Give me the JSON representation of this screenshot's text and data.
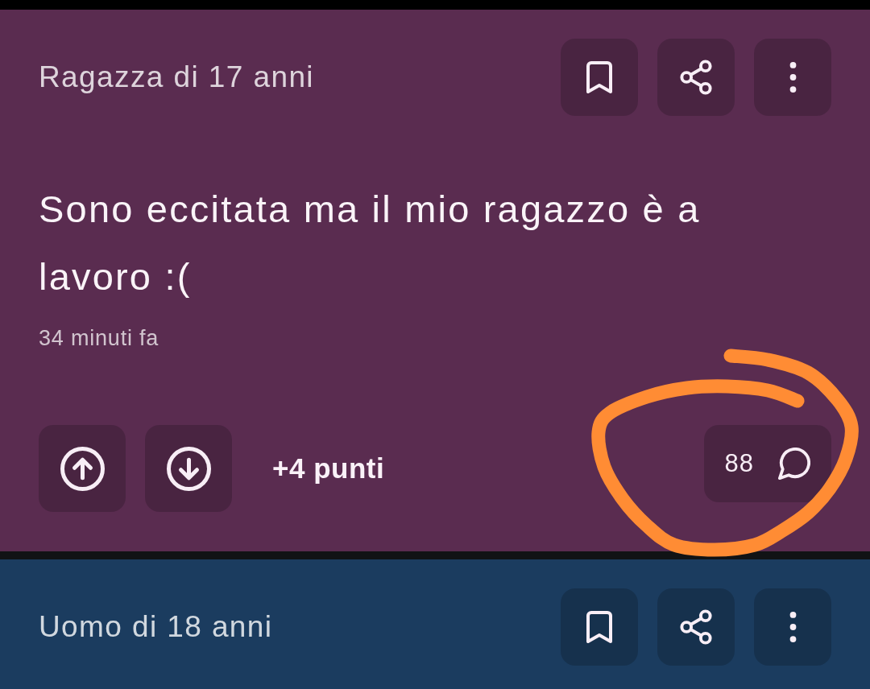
{
  "posts": [
    {
      "color": "#5a2c50",
      "author": "Ragazza di 17 anni",
      "body": "Sono eccitata ma il mio ragazzo è a lavoro :(",
      "time": "34 minuti fa",
      "points": "+4 punti",
      "comments": "88"
    },
    {
      "color": "#1b3c5f",
      "author": "Uomo di 18 anni"
    }
  ],
  "annotation": {
    "kind": "freehand-circle"
  }
}
